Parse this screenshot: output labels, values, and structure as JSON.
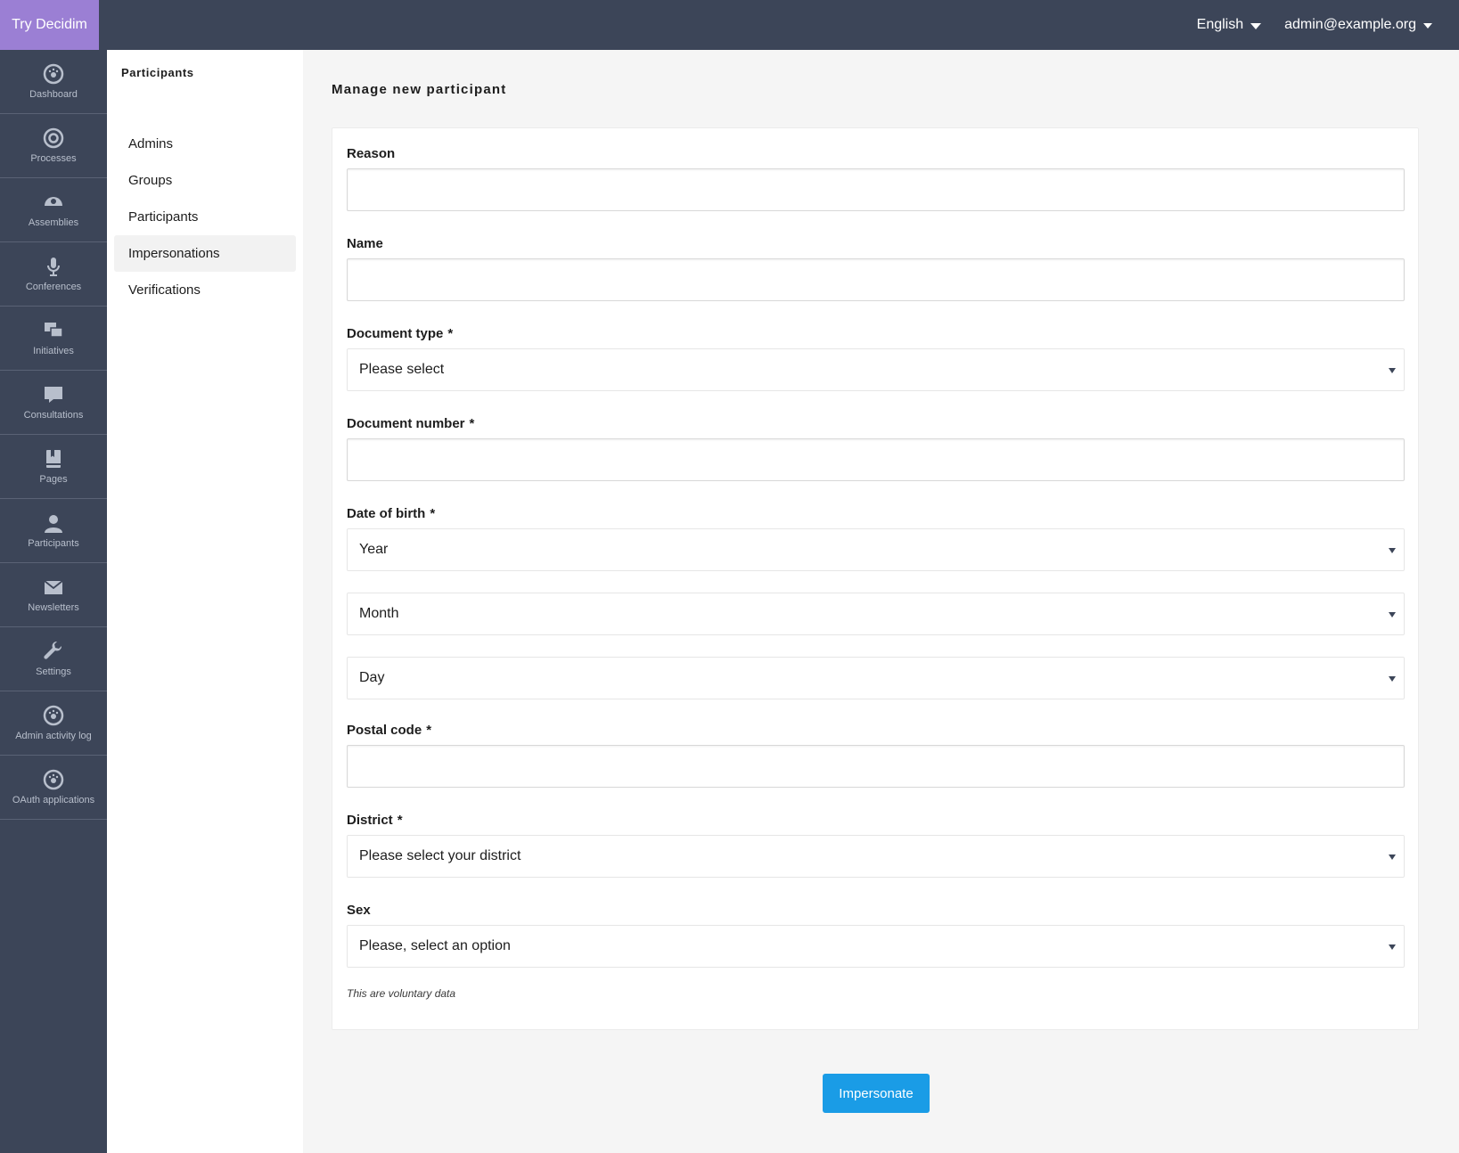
{
  "topbar": {
    "brand": "Try Decidim",
    "language": "English",
    "user": "admin@example.org"
  },
  "sidebar": {
    "items": [
      {
        "label": "Dashboard",
        "icon": "dashboard-icon"
      },
      {
        "label": "Processes",
        "icon": "processes-icon"
      },
      {
        "label": "Assemblies",
        "icon": "assemblies-icon"
      },
      {
        "label": "Conferences",
        "icon": "microphone-icon"
      },
      {
        "label": "Initiatives",
        "icon": "chat-bubbles-icon"
      },
      {
        "label": "Consultations",
        "icon": "speech-bubble-icon"
      },
      {
        "label": "Pages",
        "icon": "book-icon"
      },
      {
        "label": "Participants",
        "icon": "person-icon"
      },
      {
        "label": "Newsletters",
        "icon": "envelope-icon"
      },
      {
        "label": "Settings",
        "icon": "wrench-icon"
      },
      {
        "label": "Admin activity log",
        "icon": "dashboard-icon"
      },
      {
        "label": "OAuth applications",
        "icon": "dashboard-icon"
      }
    ]
  },
  "subnav": {
    "title": "Participants",
    "items": [
      {
        "label": "Admins"
      },
      {
        "label": "Groups"
      },
      {
        "label": "Participants"
      },
      {
        "label": "Impersonations",
        "active": true
      },
      {
        "label": "Verifications"
      }
    ]
  },
  "main": {
    "title": "Manage new participant",
    "form": {
      "reason": {
        "label": "Reason",
        "value": ""
      },
      "name": {
        "label": "Name",
        "value": ""
      },
      "document_type": {
        "label": "Document type",
        "required": "*",
        "selected": "Please select"
      },
      "document_number": {
        "label": "Document number",
        "required": "*",
        "value": ""
      },
      "date_of_birth": {
        "label": "Date of birth",
        "required": "*",
        "year": "Year",
        "month": "Month",
        "day": "Day"
      },
      "postal_code": {
        "label": "Postal code",
        "required": "*",
        "value": ""
      },
      "district": {
        "label": "District",
        "required": "*",
        "selected": "Please select your district"
      },
      "sex": {
        "label": "Sex",
        "selected": "Please, select an option"
      },
      "note": "This are voluntary data"
    },
    "submit_label": "Impersonate"
  },
  "colors": {
    "topbar": "#3c4558",
    "brand": "#9b7fd4",
    "primary_button": "#1a9ce6"
  }
}
